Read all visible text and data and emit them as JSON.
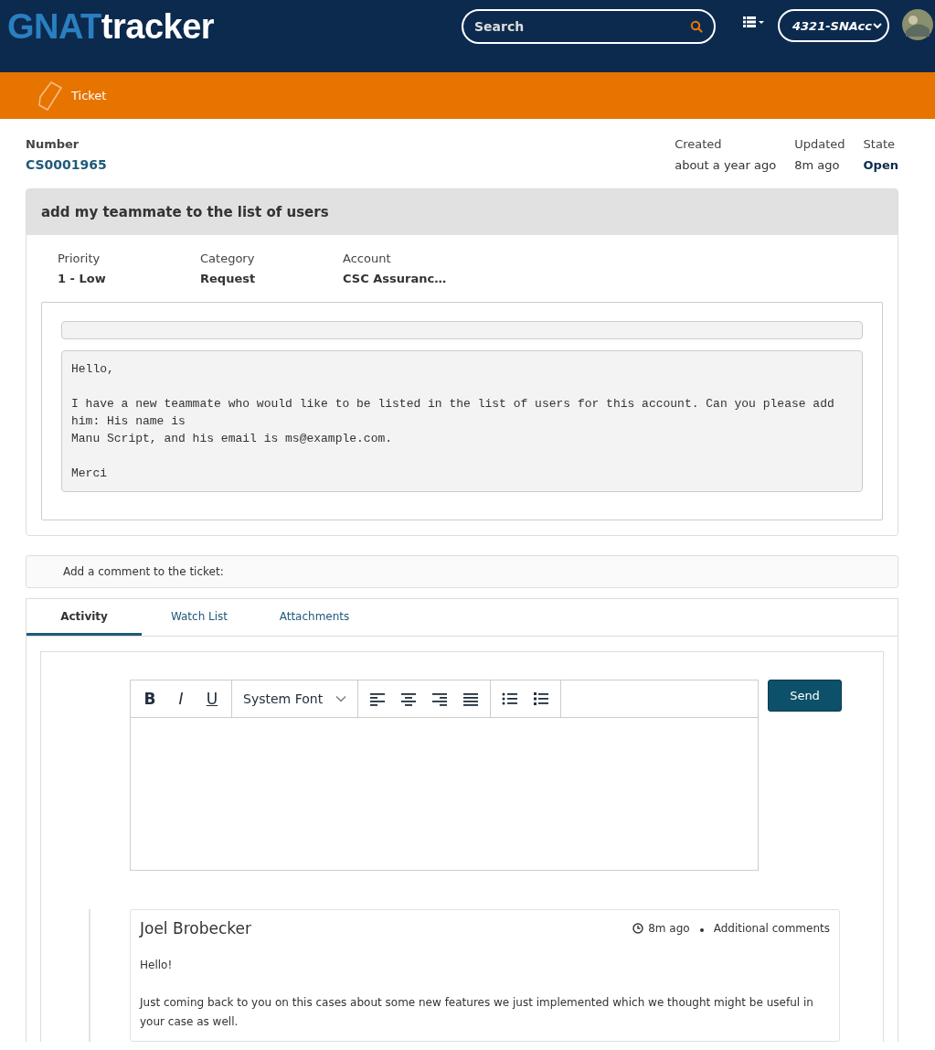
{
  "header": {
    "logo_part_1": "GNAT",
    "logo_part_2": "tracker",
    "search": {
      "placeholder": "Search"
    },
    "account_select": "4321-SNAcc"
  },
  "breadcrumb": {
    "label": "Ticket"
  },
  "ticket": {
    "number_label": "Number",
    "number": "CS0001965",
    "meta": [
      {
        "label": "Created",
        "value": "about a year ago",
        "bold": false
      },
      {
        "label": "Updated",
        "value": "8m ago",
        "bold": false
      },
      {
        "label": "State",
        "value": "Open",
        "bold": true
      }
    ],
    "title": "add my teammate to the list of users",
    "fields": [
      {
        "label": "Priority",
        "value": "1 - Low"
      },
      {
        "label": "Category",
        "value": "Request"
      },
      {
        "label": "Account",
        "value": "CSC Assuranc…"
      }
    ],
    "description": "Hello,\n\nI have a new teammate who would like to be listed in the list of users for this account. Can you please add\nhim: His name is\nManu Script, and his email is ms@example.com.\n\nMerci"
  },
  "comment_bar": "Add a comment to the ticket:",
  "tabs": [
    {
      "label": "Activity",
      "selected": true
    },
    {
      "label": "Watch List",
      "selected": false
    },
    {
      "label": "Attachments",
      "selected": false
    }
  ],
  "editor": {
    "format_buttons": [
      "B",
      "I",
      "U"
    ],
    "font": "System Font",
    "send": "Send"
  },
  "activity": [
    {
      "author": "Joel Brobecker",
      "time": "8m ago",
      "type": "Additional comments",
      "paragraphs": [
        "Hello!",
        "Just coming back to you on this cases about some new features we just implemented which we thought might be useful in your case as well."
      ]
    }
  ]
}
